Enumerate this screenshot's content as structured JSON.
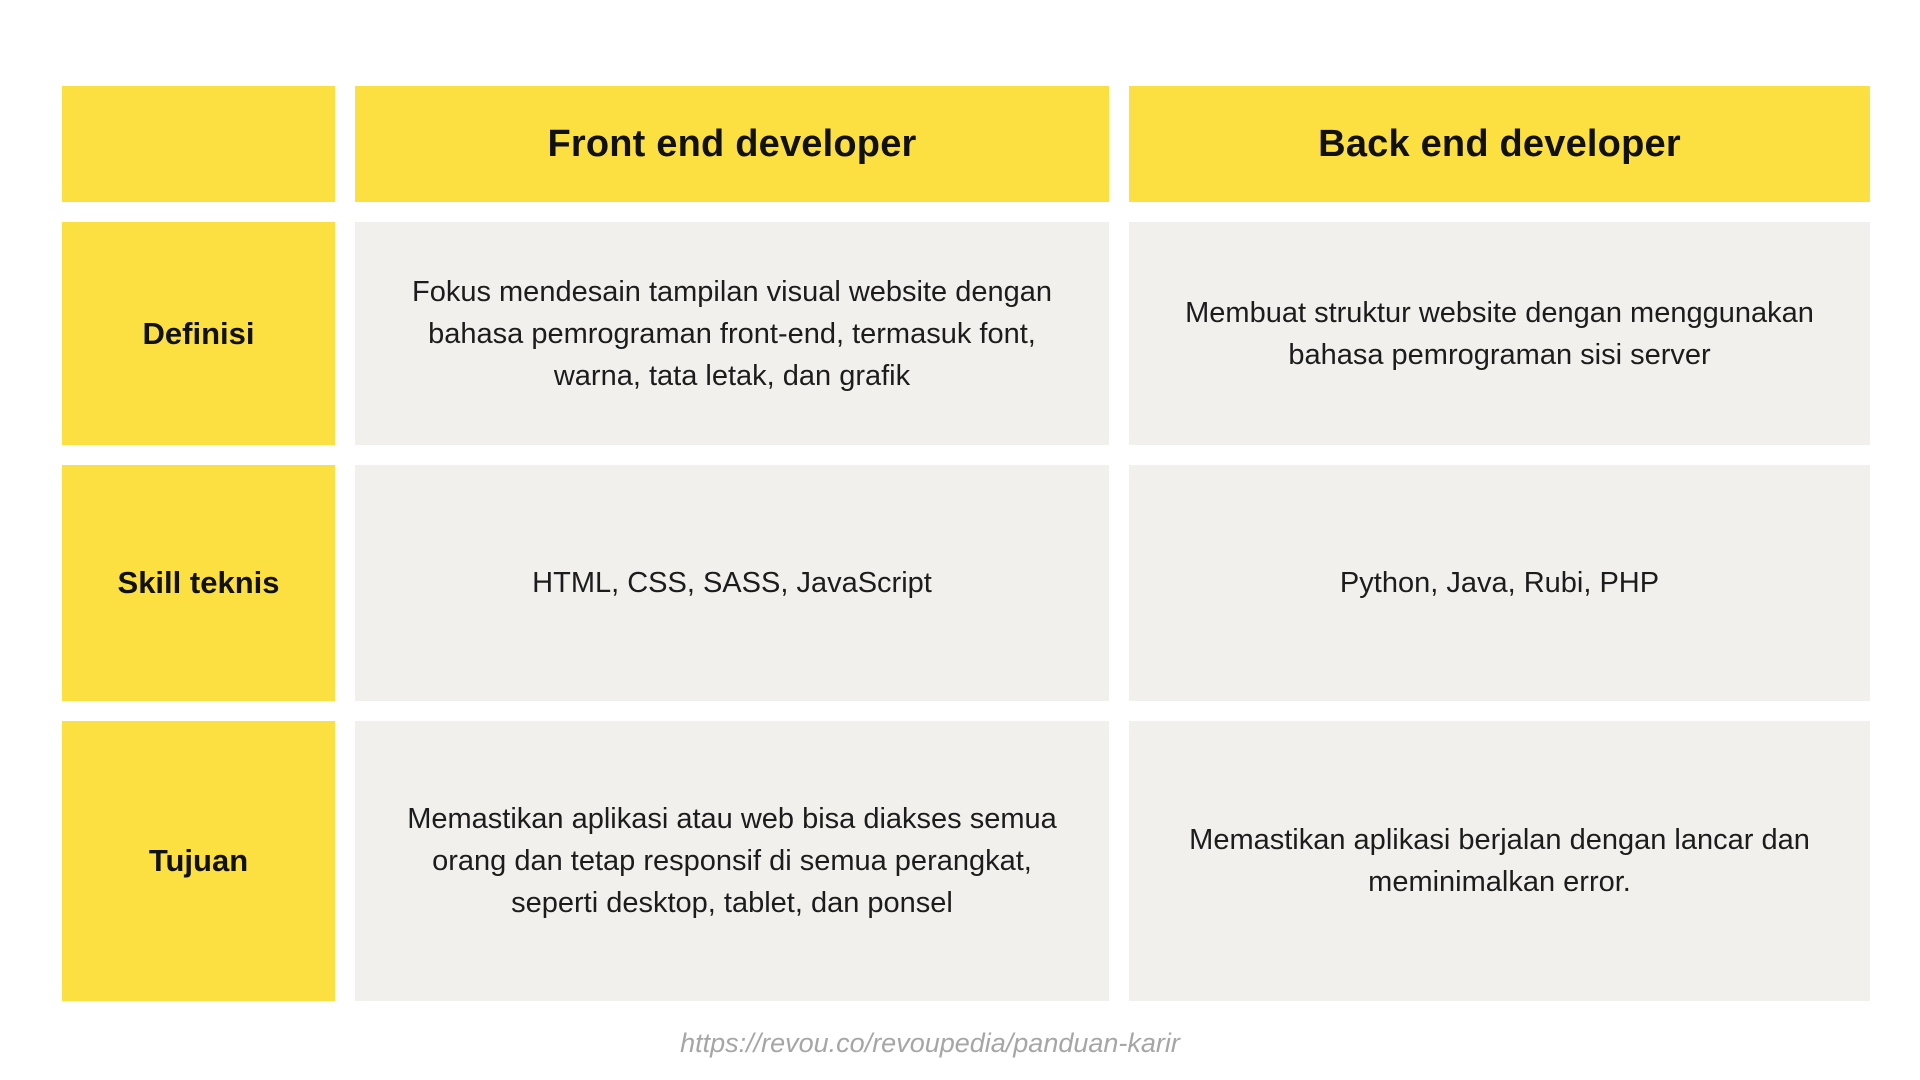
{
  "table": {
    "header": {
      "corner": "",
      "col1": "Front end developer",
      "col2": "Back end developer"
    },
    "rows": [
      {
        "label": "Definisi",
        "front": "Fokus mendesain tampilan visual website dengan\nbahasa pemrograman front-end, termasuk font,\nwarna, tata letak, dan grafik",
        "back": "Membuat struktur website dengan menggunakan\nbahasa pemrograman sisi server"
      },
      {
        "label": "Skill teknis",
        "front": "HTML, CSS, SASS, JavaScript",
        "back": "Python, Java, Rubi, PHP"
      },
      {
        "label": "Tujuan",
        "front": "Memastikan aplikasi atau web bisa diakses  semua\norang dan tetap responsif di semua perangkat,\nseperti desktop, tablet, dan ponsel",
        "back": "Memastikan aplikasi berjalan dengan lancar dan\nmeminimalkan error."
      }
    ]
  },
  "source_url": "https://revou.co/revoupedia/panduan-karir",
  "colors": {
    "accent_yellow": "#fcdf41",
    "cell_gray": "#f1f0ed",
    "text": "#111111",
    "source_text": "#a6a6a6"
  }
}
